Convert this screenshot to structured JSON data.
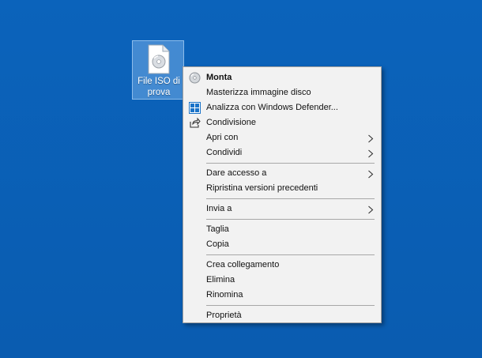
{
  "desktop": {
    "background_color": "#0a5fb4",
    "icon": {
      "label_line1": "File ISO di",
      "label_line2": "prova",
      "icon_name": "iso-file-icon"
    }
  },
  "context_menu": {
    "groups": [
      [
        {
          "label": "Monta",
          "bold": true,
          "icon": "disc-icon"
        },
        {
          "label": "Masterizza immagine disco"
        },
        {
          "label": "Analizza con Windows Defender...",
          "icon": "windows-defender-icon"
        },
        {
          "label": "Condivisione",
          "icon": "share-icon"
        },
        {
          "label": "Apri con",
          "submenu": true
        },
        {
          "label": "Condividi",
          "submenu": true
        }
      ],
      [
        {
          "label": "Dare accesso a",
          "submenu": true
        },
        {
          "label": "Ripristina versioni precedenti"
        }
      ],
      [
        {
          "label": "Invia a",
          "submenu": true
        }
      ],
      [
        {
          "label": "Taglia"
        },
        {
          "label": "Copia"
        }
      ],
      [
        {
          "label": "Crea collegamento"
        },
        {
          "label": "Elimina"
        },
        {
          "label": "Rinomina"
        }
      ],
      [
        {
          "label": "Proprietà"
        }
      ]
    ]
  }
}
